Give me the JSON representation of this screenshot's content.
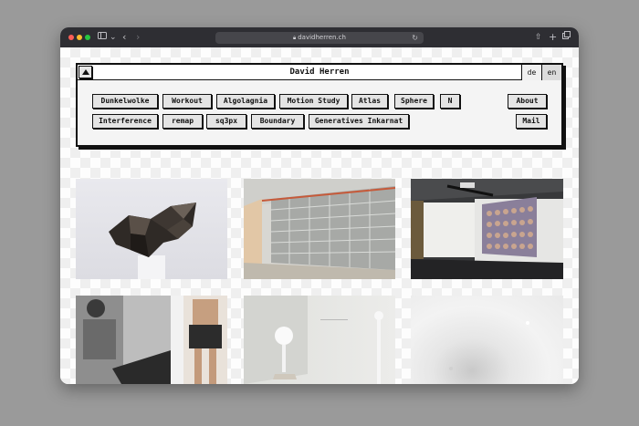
{
  "browser": {
    "url": "davidherren.ch"
  },
  "site": {
    "title": "David Herren",
    "languages": [
      "de",
      "en"
    ]
  },
  "nav": {
    "row1": [
      "Dunkelwolke",
      "Workout",
      "Algolagnia",
      "Motion Study",
      "Atlas",
      "Sphere",
      "N"
    ],
    "row2": [
      "Interference",
      "remap",
      "sq3px",
      "Boundary",
      "Generatives Inkarnat"
    ],
    "about": "About",
    "mail": "Mail"
  },
  "gallery": {
    "items": [
      "sculpture-dark-polyhedron",
      "installation-wall-panels",
      "video-projection-faces",
      "performance-bw-photos",
      "white-sphere-installation",
      "gradient-white-render"
    ]
  },
  "colors": {
    "titlebar": "#2e2e33",
    "panel_border": "#111111",
    "button_fill": "#e4e4e4"
  }
}
